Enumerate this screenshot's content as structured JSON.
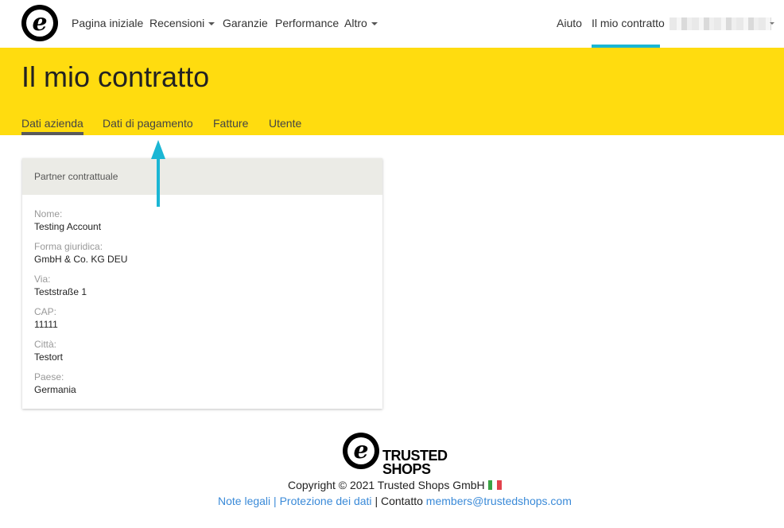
{
  "nav": {
    "home": "Pagina iniziale",
    "reviews": "Recensioni",
    "guarantees": "Garanzie",
    "performance": "Performance",
    "more": "Altro",
    "help": "Aiuto",
    "my_contract": "Il mio contratto"
  },
  "logo": {
    "letter": "e"
  },
  "header": {
    "title": "Il mio contratto",
    "tabs": [
      "Dati azienda",
      "Dati di pagamento",
      "Fatture",
      "Utente"
    ],
    "active_tab": "Dati azienda"
  },
  "card": {
    "title": "Partner contrattuale",
    "fields": [
      {
        "label": "Nome:",
        "value": "Testing Account"
      },
      {
        "label": "Forma giuridica:",
        "value": "GmbH & Co. KG DEU"
      },
      {
        "label": "Via:",
        "value": "Teststraße 1"
      },
      {
        "label": "CAP:",
        "value": "11111"
      },
      {
        "label": "Città:",
        "value": "Testort"
      },
      {
        "label": "Paese:",
        "value": "Germania"
      }
    ]
  },
  "footer": {
    "brand_line1": "TRUSTED",
    "brand_line2": "SHOPS",
    "copyright": "Copyright © 2021 Trusted Shops GmbH",
    "legal_link": "Note legali",
    "privacy_link": "Protezione dei dati",
    "separator": "|",
    "contact_label": "Contatto",
    "contact_email": "members@trustedshops.com"
  },
  "colors": {
    "header_yellow": "#ffdc0f",
    "active_accent": "#1bb6d4",
    "arrow": "#1bb6d4",
    "link": "#3a8ad8"
  }
}
